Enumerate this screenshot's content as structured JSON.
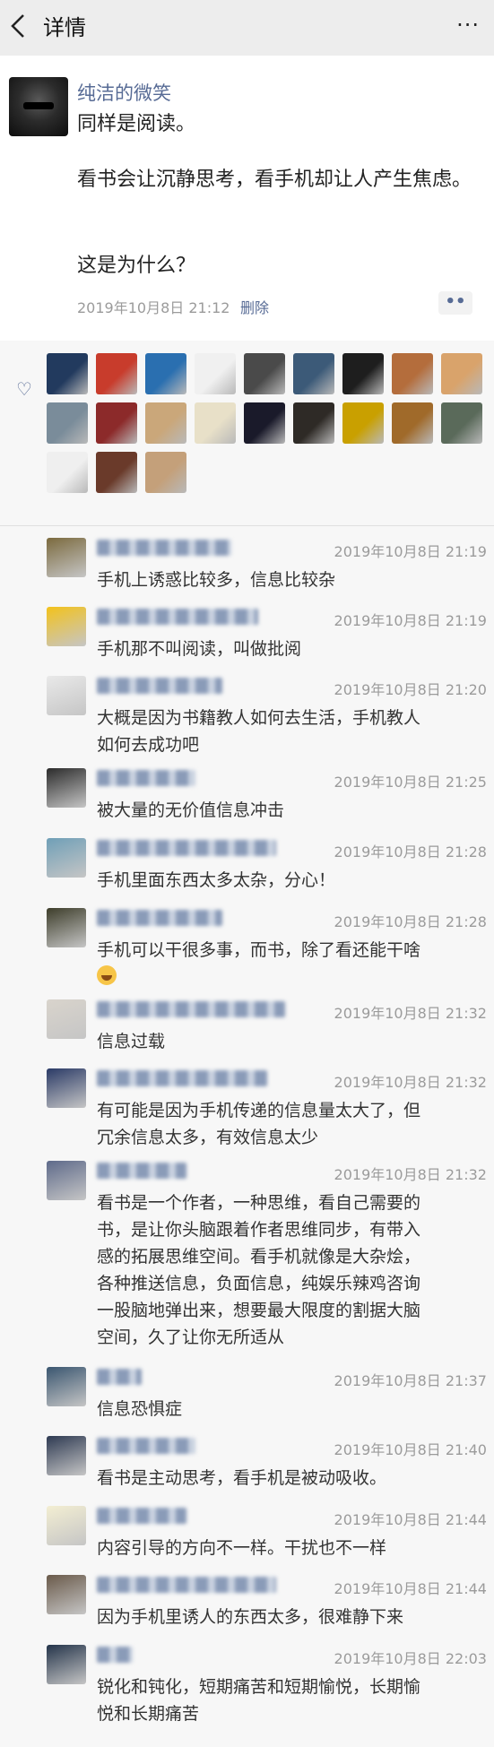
{
  "header": {
    "back_icon": "chevron-left-icon",
    "title": "详情",
    "more_label": "···"
  },
  "post": {
    "author": "纯洁的微笑",
    "paragraphs": [
      "同样是阅读。",
      "看书会让沉静思考，看手机却让人产生焦虑。",
      "这是为什么？"
    ],
    "timestamp": "2019年10月8日 21:12",
    "delete_label": "删除",
    "more_label": "••"
  },
  "likes": {
    "icon": "heart-outline-icon",
    "avatar_colors": [
      "#223a5e",
      "#c83c2c",
      "#2a6fb0",
      "#f0f0f0",
      "#4a4a4a",
      "#3c5a78",
      "#1e1e1e",
      "#b46d3c",
      "#d9a36b",
      "#7a8c9a",
      "#8c2a2a",
      "#caa77a",
      "#e8e0c8",
      "#1a1a2a",
      "#2e2a26",
      "#c9a000",
      "#a06a2a",
      "#5a6a5a",
      "#efefef",
      "#6a3a2a",
      "#c4a07a"
    ],
    "accent_color": "#576b95"
  },
  "comments": [
    {
      "time": "2019年10月8日 21:19",
      "lines": [
        "手机上诱惑比较多，信息比较杂"
      ],
      "avatar_color": "#7b6a3e",
      "name_w": 150
    },
    {
      "time": "2019年10月8日 21:19",
      "lines": [
        "手机那不叫阅读，叫做批阅"
      ],
      "avatar_color": "#f3c21b",
      "name_w": 180
    },
    {
      "time": "2019年10月8日 21:20",
      "lines": [
        "大概是因为书籍教人如何去生活，手机教人",
        "如何去成功吧"
      ],
      "avatar_color": "#e9e9e9",
      "name_w": 140
    },
    {
      "time": "2019年10月8日 21:25",
      "lines": [
        "被大量的无价值信息冲击"
      ],
      "avatar_color": "#2b2b2b",
      "name_w": 110
    },
    {
      "time": "2019年10月8日 21:28",
      "lines": [
        "手机里面东西太多太杂，分心！"
      ],
      "avatar_color": "#6f9fb7",
      "name_w": 200
    },
    {
      "time": "2019年10月8日 21:28",
      "lines": [
        "手机可以干很多事，而书，除了看还能干啥"
      ],
      "avatar_color": "#3d3d2a",
      "name_w": 140,
      "emoji": "grinning-face-emoji"
    },
    {
      "time": "2019年10月8日 21:32",
      "lines": [
        "信息过载"
      ],
      "avatar_color": "#d9d4cc",
      "name_w": 210
    },
    {
      "time": "2019年10月8日 21:32",
      "lines": [
        "有可能是因为手机传递的信息量太大了，但",
        "冗余信息太多，有效信息太少"
      ],
      "avatar_color": "#2a3a66",
      "name_w": 190
    },
    {
      "time": "2019年10月8日 21:32",
      "lines": [
        "看书是一个作者，一种思维，看自己需要的",
        "书，是让你头脑跟着作者思维同步，有带入",
        "感的拓展思维空间。看手机就像是大杂烩，",
        "各种推送信息，负面信息，纯娱乐辣鸡咨询",
        "一股脑地弹出来，想要最大限度的割据大脑",
        "空间，久了让你无所适从"
      ],
      "avatar_color": "#5e6a8a",
      "name_w": 100
    },
    {
      "time": "2019年10月8日 21:37",
      "lines": [
        "信息恐惧症"
      ],
      "avatar_color": "#3a5670",
      "name_w": 50
    },
    {
      "time": "2019年10月8日 21:40",
      "lines": [
        "看书是主动思考，看手机是被动吸收。"
      ],
      "avatar_color": "#2e3a52",
      "name_w": 110
    },
    {
      "time": "2019年10月8日 21:44",
      "lines": [
        "内容引导的方向不一样。干扰也不一样"
      ],
      "avatar_color": "#f3eed2",
      "name_w": 100
    },
    {
      "time": "2019年10月8日 21:44",
      "lines": [
        "因为手机里诱人的东西太多，很难静下来"
      ],
      "avatar_color": "#6a5a4a",
      "name_w": 200
    },
    {
      "time": "2019年10月8日 22:03",
      "lines": [
        "锐化和钝化，短期痛苦和短期愉悦，长期愉",
        "悦和长期痛苦"
      ],
      "avatar_color": "#24344a",
      "name_w": 40
    }
  ]
}
